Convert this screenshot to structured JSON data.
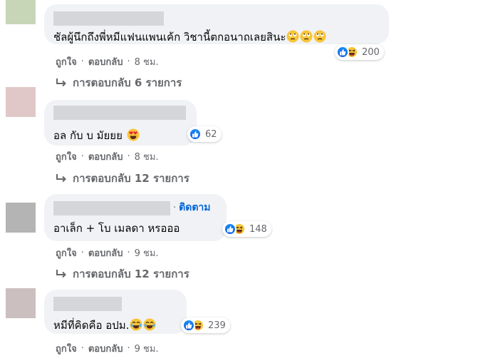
{
  "comments": [
    {
      "text": "ชัลผู้นึกถึงพี่หมีแฟนแพนเค้ก วิชานี้ตกอนาถเลยสินะ",
      "text_emoji": "eyes-rolling-emoji",
      "reactions": {
        "icons": [
          "like-icon",
          "haha-icon"
        ],
        "count": "200"
      },
      "actions": {
        "like": "ถูกใจ",
        "reply": "ตอบกลับ",
        "time": "8 ชม."
      },
      "replies_label": "การตอบกลับ 6 รายการ",
      "avatar_color": "#c8d6b8"
    },
    {
      "text": "อล กับ บ มัยยย",
      "text_emoji": "heart-eyes-emoji",
      "reactions": {
        "icons": [
          "like-icon"
        ],
        "count": "62"
      },
      "actions": {
        "like": "ถูกใจ",
        "reply": "ตอบกลับ",
        "time": "8 ชม."
      },
      "replies_label": "การตอบกลับ 12 รายการ",
      "avatar_color": "#e0c8c8"
    },
    {
      "follow_label": "ติดตาม",
      "text": "อาเล็ก + โบ เมลดา หรอออ",
      "reactions": {
        "icons": [
          "like-icon",
          "haha-icon"
        ],
        "count": "148"
      },
      "actions": {
        "like": "ถูกใจ",
        "reply": "ตอบกลับ",
        "time": "9 ชม."
      },
      "replies_label": "การตอบกลับ 12 รายการ",
      "avatar_color": "#b4b4b4"
    },
    {
      "text": "หมีที่คิดคือ อปม.",
      "text_emoji": "tears-of-joy-emoji",
      "reactions": {
        "icons": [
          "like-icon",
          "haha-icon"
        ],
        "count": "239"
      },
      "actions": {
        "like": "ถูกใจ",
        "reply": "ตอบกลับ",
        "time": "9 ชม."
      },
      "avatar_color": "#cbbfbf"
    }
  ],
  "colors": {
    "bubble": "#f0f2f5",
    "secondary_text": "#65676b",
    "link": "#0566d8",
    "like_blue": "#1877f2",
    "emoji_yellow": "#f8c537"
  }
}
